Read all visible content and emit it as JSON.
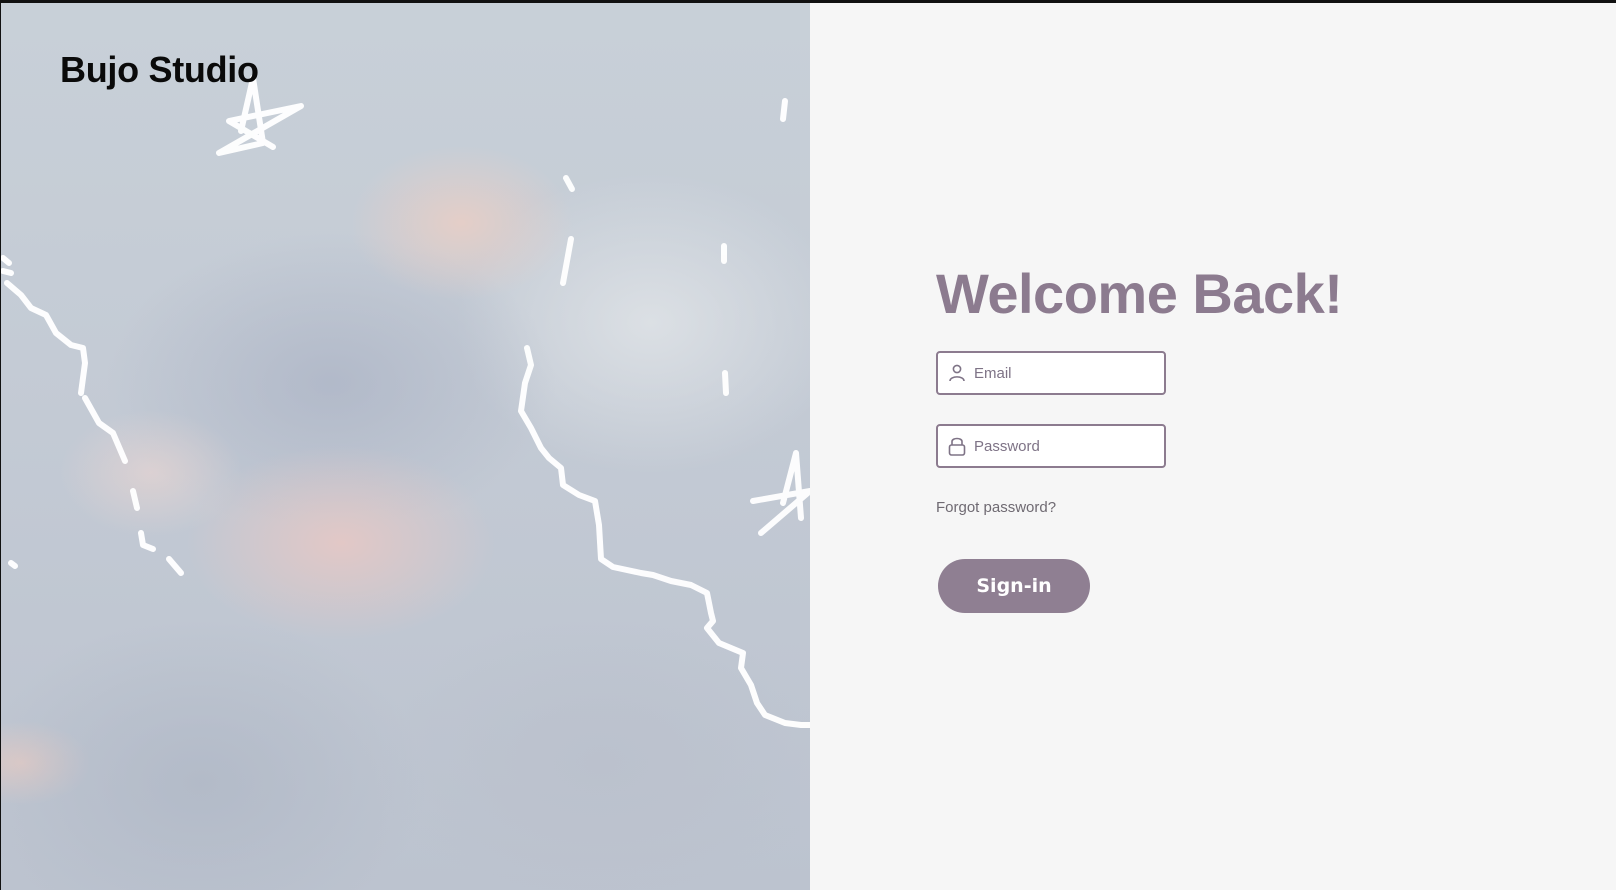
{
  "brand": {
    "name": "Bujo Studio"
  },
  "login": {
    "heading": "Welcome Back!",
    "email_placeholder": "Email",
    "password_placeholder": "Password",
    "forgot_link": "Forgot password?",
    "submit_label": "Sign-in"
  },
  "theme": {
    "accent": "#8c7b8f",
    "button": "#8f7f92",
    "panel_background": "#f6f6f6"
  },
  "icons": {
    "email_field": "user-icon",
    "password_field": "lock-icon"
  }
}
